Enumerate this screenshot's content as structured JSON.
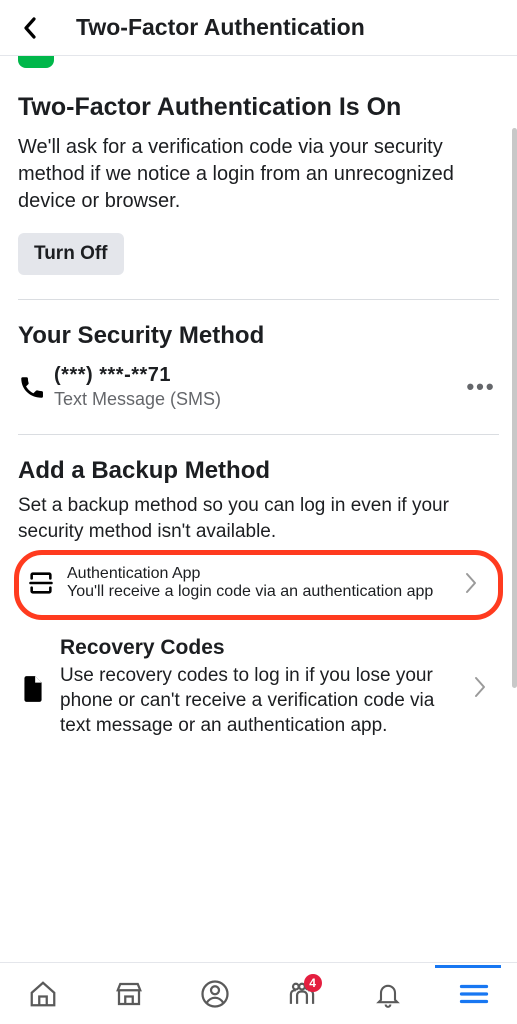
{
  "header": {
    "title": "Two-Factor Authentication"
  },
  "status": {
    "heading": "Two-Factor Authentication Is On",
    "body": "We'll ask for a verification code via your security method if we notice a login from an unrecognized device or browser.",
    "turn_off_label": "Turn Off"
  },
  "security": {
    "heading": "Your Security Method",
    "phone_masked": "(***) ***-**71",
    "phone_sub": "Text Message (SMS)"
  },
  "backup": {
    "heading": "Add a Backup Method",
    "sub": "Set a backup method so you can log in even if your security method isn't available.",
    "items": [
      {
        "title": "Authentication App",
        "desc": "You'll receive a login code via an authentication app"
      },
      {
        "title": "Recovery Codes",
        "desc": "Use recovery codes to log in if you lose your phone or can't receive a verification code via text message or an authentication app."
      }
    ]
  },
  "tabbar": {
    "badge_count": "4"
  }
}
